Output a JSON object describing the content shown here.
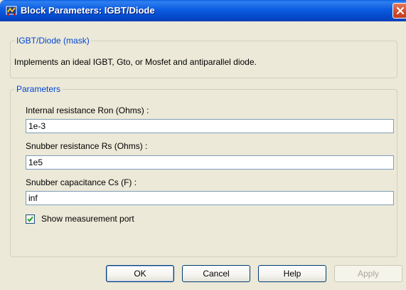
{
  "window": {
    "title": "Block Parameters: IGBT/Diode",
    "icon": "simulink-block-icon",
    "close_icon": "close-icon"
  },
  "mask": {
    "legend": "IGBT/Diode (mask)",
    "description": "Implements an ideal IGBT, Gto, or Mosfet and antiparallel diode."
  },
  "parameters": {
    "legend": "Parameters",
    "ron_label": "Internal resistance Ron (Ohms) :",
    "ron_value": "1e-3",
    "rs_label": "Snubber resistance Rs (Ohms) :",
    "rs_value": "1e5",
    "cs_label": "Snubber capacitance Cs (F) :",
    "cs_value": "inf",
    "show_port_label": "Show measurement port",
    "show_port_checked": true
  },
  "buttons": {
    "ok": "OK",
    "cancel": "Cancel",
    "help": "Help",
    "apply": "Apply"
  },
  "colors": {
    "titlebar": "#0a5fe3",
    "legend_text": "#0046d5",
    "window_bg": "#ece9d8",
    "close_button": "#d14a2b"
  }
}
